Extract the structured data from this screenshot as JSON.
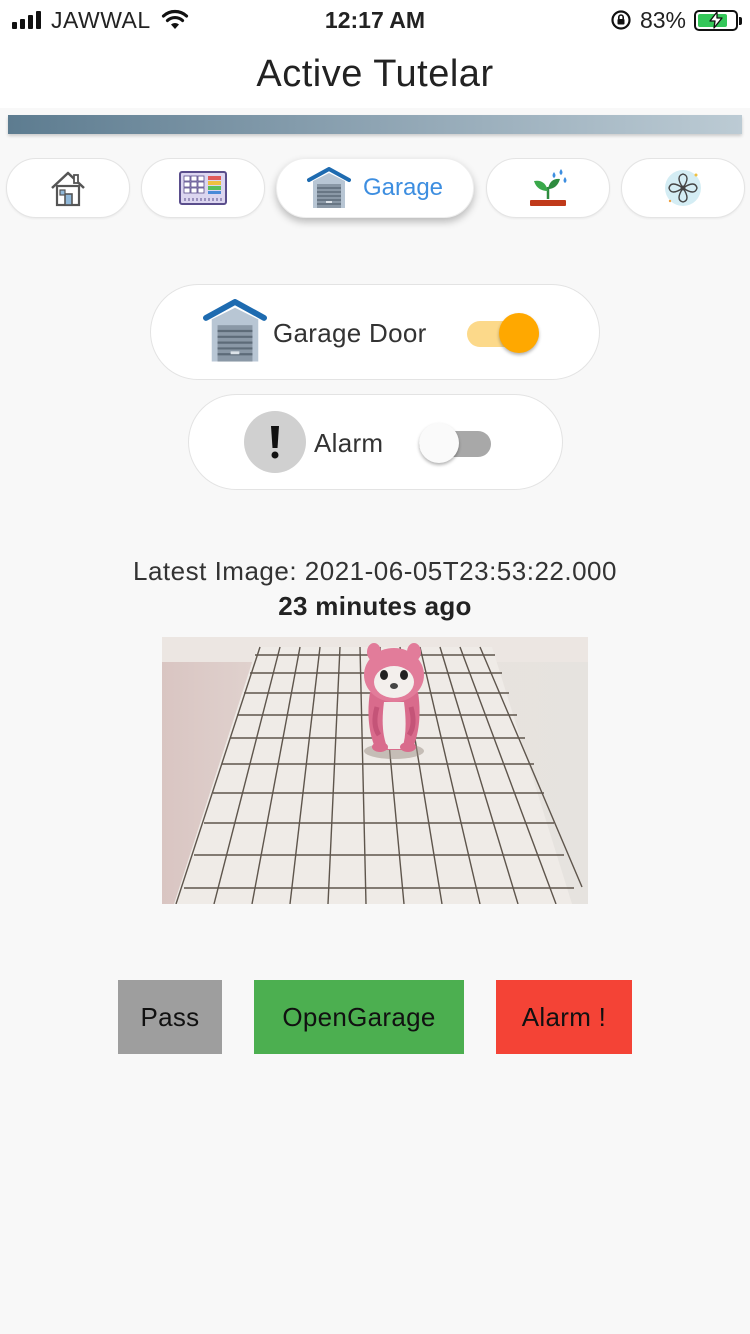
{
  "status_bar": {
    "carrier": "JAWWAL",
    "time": "12:17 AM",
    "battery_percent": "83%",
    "icons": [
      "signal-icon",
      "wifi-icon",
      "rotation-lock-icon",
      "battery-charging-icon"
    ]
  },
  "header": {
    "title": "Active Tutelar"
  },
  "tabs": [
    {
      "icon": "house-icon",
      "label": "",
      "active": false
    },
    {
      "icon": "control-panel-icon",
      "label": "",
      "active": false
    },
    {
      "icon": "garage-icon",
      "label": "Garage",
      "active": true
    },
    {
      "icon": "plant-watering-icon",
      "label": "",
      "active": false
    },
    {
      "icon": "fan-icon",
      "label": "",
      "active": false
    }
  ],
  "controls": {
    "garage_door": {
      "label": "Garage Door",
      "icon": "garage-icon",
      "on": true
    },
    "alarm": {
      "label": "Alarm",
      "icon": "exclamation-icon",
      "on": false
    }
  },
  "latest": {
    "label": "Latest Image: 2021-06-05T23:53:22.000",
    "ago": "23 minutes ago"
  },
  "actions": {
    "pass": "Pass",
    "open_garage": "OpenGarage",
    "alarm": "Alarm !"
  },
  "colors": {
    "accent_blue": "#3d8ee0",
    "switch_on_thumb": "#ffa800",
    "switch_on_track": "#fcd98a",
    "pass_button": "#9e9e9e",
    "open_button": "#4caf50",
    "alarm_button": "#f44336"
  }
}
